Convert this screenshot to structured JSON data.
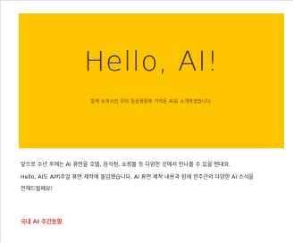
{
  "banner": {
    "title": "Hello, AI!",
    "subtitle": "함께 소개시킨 우리 일상생활에 가까운 AI를 소개하겠습니다.",
    "background_color": "#fdc400"
  },
  "description": {
    "line1": "앞으로 수년 후에는 AI 휴먼을 호텔, 음식점, 쇼핑몰 등 다양한 곳에서 만나볼 수 있을 텐데요.",
    "line2": "Hello, AI도 AI버추얼 휴먼 제작에 돌입했습니다. AI 휴먼 제작 내용과 함께 한주간의 다양한 AI 소식을",
    "line3": "전해드릴께요!"
  },
  "news_link": {
    "label": "국내 AI 주간동향",
    "color": "#d63b2f"
  }
}
